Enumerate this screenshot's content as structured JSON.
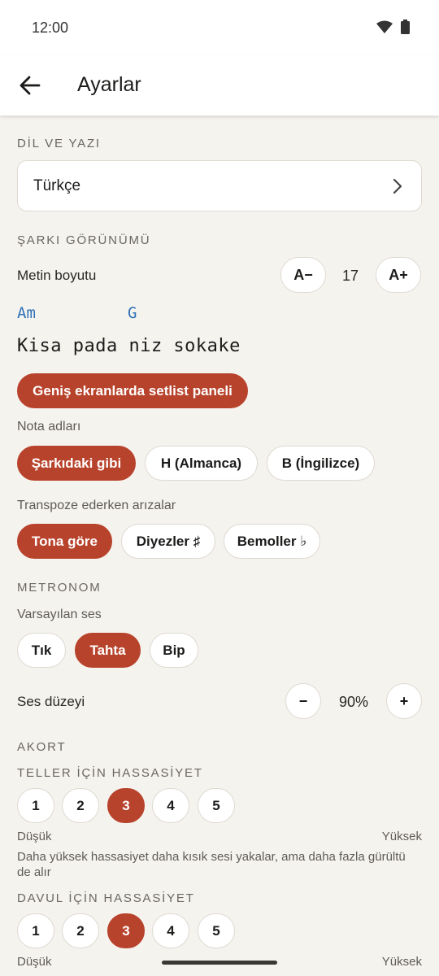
{
  "status": {
    "time": "12:00",
    "wifi_icon": "wifi-icon",
    "battery_icon": "battery-icon"
  },
  "appbar": {
    "title": "Ayarlar",
    "back_icon": "arrow-back-icon"
  },
  "language": {
    "section": "DİL VE YAZI",
    "selected": "Türkçe"
  },
  "song_view": {
    "section": "ŞARKI GÖRÜNÜMÜ",
    "text_size_label": "Metin boyutu",
    "decrease_label": "A−",
    "increase_label": "A+",
    "text_size_value": "17",
    "preview_chord_1": "Am",
    "preview_chord_2": "G",
    "preview_lyric": "Kisa pada niz sokake",
    "setlist_panel_label": "Geniş ekranlarda setlist paneli",
    "note_names_label": "Nota adları",
    "note_names_options": [
      "Şarkıdaki gibi",
      "H (Almanca)",
      "B (İngilizce)"
    ],
    "note_names_selected": 0,
    "accidentals_label": "Transpoze ederken arızalar",
    "accidentals_options": [
      "Tona göre",
      "Diyezler ♯",
      "Bemoller ♭"
    ],
    "accidentals_selected": 0
  },
  "metronome": {
    "section": "METRONOM",
    "default_sound_label": "Varsayılan ses",
    "sound_options": [
      "Tık",
      "Tahta",
      "Bip"
    ],
    "sound_selected": 1,
    "volume_label": "Ses düzeyi",
    "volume_minus": "−",
    "volume_plus": "+",
    "volume_value": "90%"
  },
  "tuner": {
    "section": "AKORT",
    "strings_label": "TELLER İÇİN HASSASİYET",
    "levels": [
      "1",
      "2",
      "3",
      "4",
      "5"
    ],
    "strings_selected": 2,
    "low_label": "Düşük",
    "high_label": "Yüksek",
    "help_text": "Daha yüksek hassasiyet daha kısık sesi yakalar, ama daha fazla gürültü de alır",
    "drums_label": "DAVUL İÇİN HASSASİYET",
    "drums_selected": 2
  },
  "colors": {
    "accent": "#b8432c",
    "chord": "#2f72b8",
    "background": "#f5f3ee"
  }
}
